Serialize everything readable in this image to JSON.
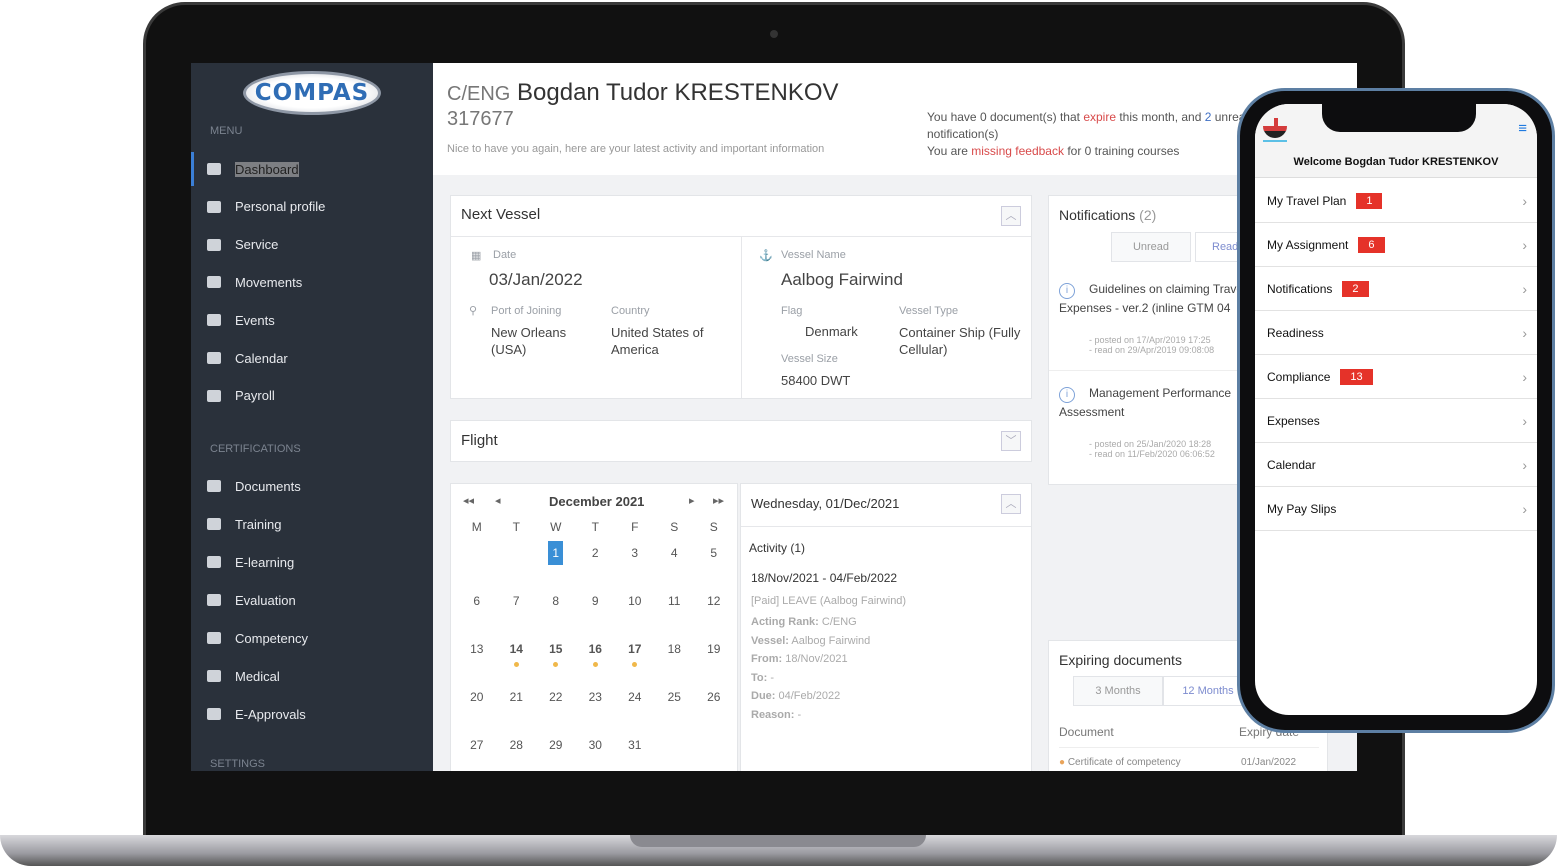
{
  "sidebar": {
    "logo": "COMPAS",
    "menu_label": "MENU",
    "items": [
      {
        "label": "Dashboard",
        "icon": "home-icon"
      },
      {
        "label": "Personal profile",
        "icon": "user-icon"
      },
      {
        "label": "Service",
        "icon": "service-icon"
      },
      {
        "label": "Movements",
        "icon": "movements-icon"
      },
      {
        "label": "Events",
        "icon": "events-icon"
      },
      {
        "label": "Calendar",
        "icon": "calendar-icon"
      },
      {
        "label": "Payroll",
        "icon": "payroll-icon"
      }
    ],
    "cert_label": "CERTIFICATIONS",
    "cert_items": [
      {
        "label": "Documents",
        "icon": "documents-icon"
      },
      {
        "label": "Training",
        "icon": "training-icon"
      },
      {
        "label": "E-learning",
        "icon": "elearning-icon"
      },
      {
        "label": "Evaluation",
        "icon": "evaluation-icon"
      },
      {
        "label": "Competency",
        "icon": "competency-icon"
      },
      {
        "label": "Medical",
        "icon": "medical-icon"
      },
      {
        "label": "E-Approvals",
        "icon": "eapprovals-icon"
      }
    ],
    "settings_label": "SETTINGS"
  },
  "header": {
    "rank": "C/ENG",
    "name": "Bogdan Tudor KRESTENKOV",
    "id": "317677",
    "subtitle": "Nice to have you again, here are your latest activity and important information",
    "info1_a": "You have 0 document(s) that ",
    "info1_expire": "expire",
    "info1_b": " this month, and ",
    "info1_count": "2",
    "info1_c": " unread",
    "info1_d": "notification(s)",
    "info2_a": "You are ",
    "info2_missing": "missing feedback",
    "info2_b": " for 0 training courses"
  },
  "next_vessel": {
    "title": "Next Vessel",
    "date_label": "Date",
    "date": "03/Jan/2022",
    "port_label": "Port of Joining",
    "port": "New Orleans (USA)",
    "country_label": "Country",
    "country": "United States of America",
    "vessel_label": "Vessel Name",
    "vessel": "Aalbog Fairwind",
    "flag_label": "Flag",
    "flag": "Denmark",
    "type_label": "Vessel Type",
    "type": "Container Ship (Fully Cellular)",
    "size_label": "Vessel Size",
    "size": "58400 DWT"
  },
  "flight": {
    "title": "Flight"
  },
  "calendar": {
    "month": "December 2021",
    "weekdays": [
      "M",
      "T",
      "W",
      "T",
      "F",
      "S",
      "S"
    ],
    "first_weekday": 2,
    "days": 31,
    "selected": 1,
    "event_days": [
      14,
      15,
      16,
      17
    ]
  },
  "day_detail": {
    "title": "Wednesday, 01/Dec/2021",
    "activity": "Activity (1)",
    "range": "18/Nov/2021 - 04/Feb/2022",
    "desc": "[Paid] LEAVE (Aalbog Fairwind)",
    "fields": [
      {
        "k": "Acting Rank:",
        "v": " C/ENG"
      },
      {
        "k": "Vessel:",
        "v": " Aalbog Fairwind"
      },
      {
        "k": "From:",
        "v": " 18/Nov/2021"
      },
      {
        "k": "To:",
        "v": " -"
      },
      {
        "k": "Due:",
        "v": " 04/Feb/2022"
      },
      {
        "k": "Reason:",
        "v": " -"
      }
    ]
  },
  "notifications": {
    "title": "Notifications",
    "count": "(2)",
    "tabs": [
      "Unread",
      "Read"
    ],
    "items": [
      {
        "title": "Guidelines on claiming Travel Expenses - ver.2 (inline GTM 04",
        "posted": "- posted on 17/Apr/2019 17:25",
        "read": "- read on 29/Apr/2019 09:08:08"
      },
      {
        "title": "Management Performance Assessment",
        "posted": "- posted on 25/Jan/2020 18:28",
        "read": "- read on 11/Feb/2020 06:06:52"
      }
    ]
  },
  "expiring": {
    "title": "Expiring documents",
    "tabs": [
      "3 Months",
      "12 Months"
    ],
    "col_doc": "Document",
    "col_exp": "Expiry date",
    "rows": [
      {
        "doc": "Certificate of competency",
        "date": "01/Jan/2022"
      }
    ]
  },
  "phone": {
    "welcome": "Welcome Bogdan Tudor KRESTENKOV",
    "items": [
      {
        "label": "My Travel Plan",
        "badge": "1"
      },
      {
        "label": "My Assignment",
        "badge": "6"
      },
      {
        "label": "Notifications",
        "badge": "2"
      },
      {
        "label": "Readiness",
        "badge": ""
      },
      {
        "label": "Compliance",
        "badge": "13"
      },
      {
        "label": "Expenses",
        "badge": ""
      },
      {
        "label": "Calendar",
        "badge": ""
      },
      {
        "label": "My Pay Slips",
        "badge": ""
      }
    ]
  },
  "colors": {
    "sidebar": "#2a313b",
    "accent": "#3b7fd6",
    "badge": "#e53229",
    "highlight": "#d84a4a"
  }
}
